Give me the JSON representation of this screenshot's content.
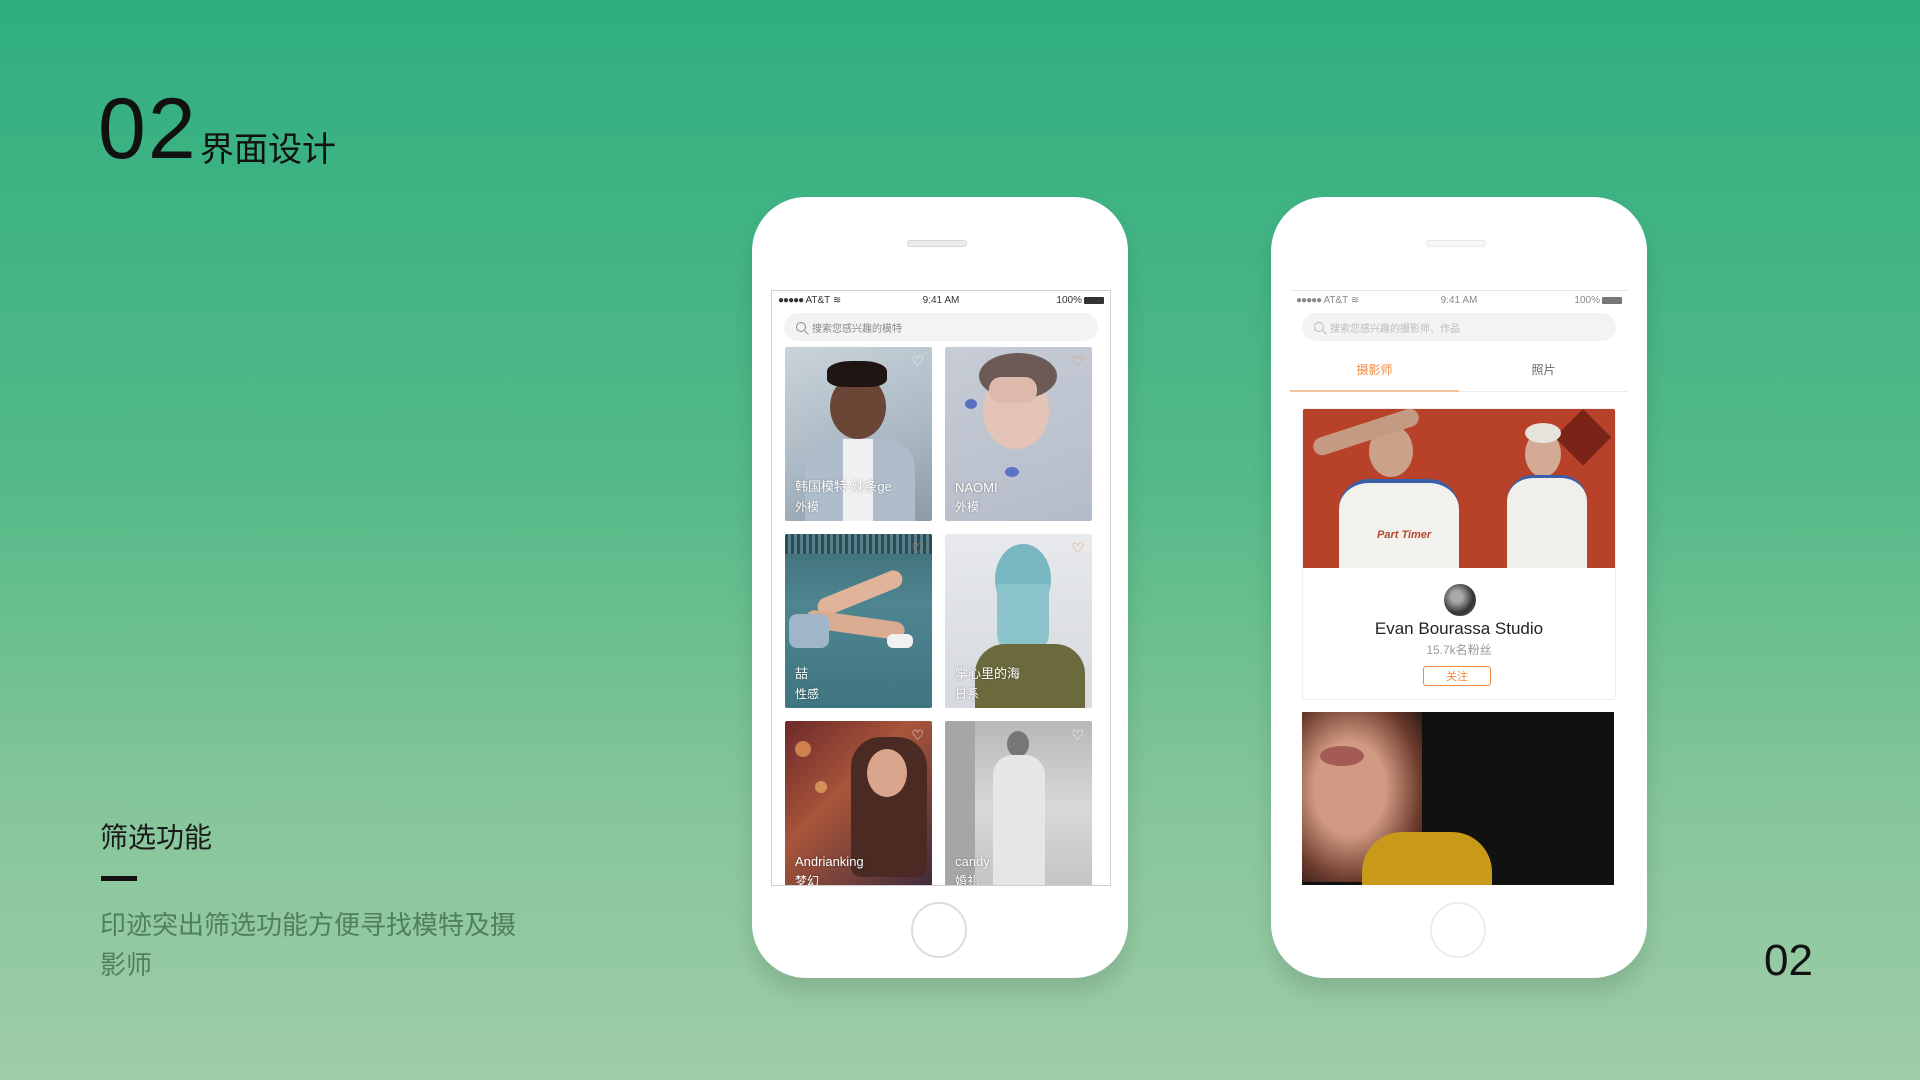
{
  "slide": {
    "number": "02",
    "title": "界面设计",
    "section_title": "筛选功能",
    "section_desc": "印迹突出筛选功能方便寻找模特及摄影师",
    "page_number": "02"
  },
  "phone1": {
    "status": {
      "carrier": "AT&T",
      "time": "9:41 AM",
      "battery": "100%"
    },
    "search_placeholder": "搜索您感兴趣的模特",
    "cards": [
      {
        "name": "韩国模特·辣条ge",
        "tag": "外模",
        "heart": "white"
      },
      {
        "name": "NAOMI",
        "tag": "外模",
        "heart": "orange"
      },
      {
        "name": "喆",
        "tag": "性感",
        "heart": "orange"
      },
      {
        "name": "掌心里的海",
        "tag": "日系",
        "heart": "orange"
      },
      {
        "name": "Andrianking",
        "tag": "梦幻",
        "heart": "white"
      },
      {
        "name": "candy",
        "tag": "婚礼",
        "heart": "white"
      }
    ]
  },
  "phone2": {
    "status": {
      "carrier": "AT&T",
      "time": "9:41 AM",
      "battery": "100%"
    },
    "search_placeholder": "搜索您感兴趣的摄影师、作品",
    "tabs": [
      "摄影师",
      "照片"
    ],
    "photographer": {
      "name": "Evan Bourassa Studio",
      "fans": "15.7k名粉丝",
      "follow_label": "关注",
      "shirt_text": "Part Timer"
    }
  },
  "colors": {
    "accent": "#f2883e",
    "bg_top": "#2fae80",
    "bg_bottom": "#9fcda8"
  },
  "icons": {
    "heart": "heart-icon",
    "search": "search-icon",
    "wifi": "wifi-icon",
    "battery": "battery-icon"
  }
}
